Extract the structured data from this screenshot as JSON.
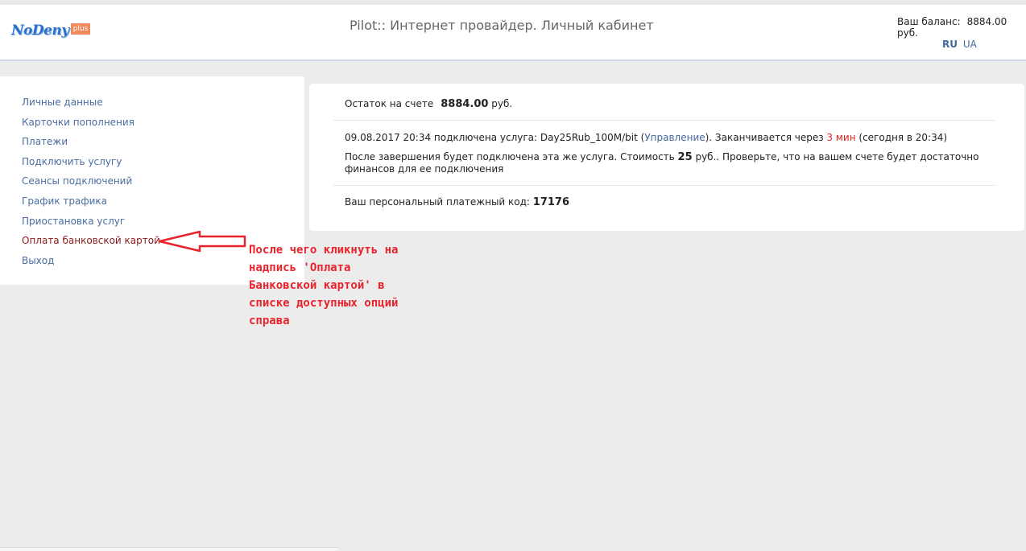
{
  "header": {
    "logo_text": "NoDeny",
    "logo_badge": "plus",
    "title": "Pilot:: Интернет провайдер. Личный кабинет",
    "balance_label": "Ваш баланс:",
    "balance_value": "8884.00 руб.",
    "languages": [
      "RU",
      "UA"
    ],
    "active_language": "RU"
  },
  "sidebar": {
    "items": [
      {
        "label": "Личные данные"
      },
      {
        "label": "Карточки пополнения"
      },
      {
        "label": "Платежи"
      },
      {
        "label": "Подключить услугу"
      },
      {
        "label": "Сеансы подключений"
      },
      {
        "label": "График трафика"
      },
      {
        "label": "Приостановка услуг"
      },
      {
        "label": "Оплата банковской картой",
        "active": true
      },
      {
        "label": "Выход"
      }
    ]
  },
  "main": {
    "balance_label": "Остаток на счете",
    "balance_amount": "8884.00",
    "balance_currency": "руб.",
    "service_prefix": "09.08.2017 20:34 подключена услуга: Day25Rub_100M/bit (",
    "service_link": "Управление",
    "service_mid": "). Заканчивается через ",
    "service_remaining": "3 мин",
    "service_suffix": " (сегодня в 20:34)",
    "renewal_prefix": "После завершения будет подключена эта же услуга. Стоимость ",
    "renewal_cost": "25",
    "renewal_suffix": " руб.. Проверьте, что на вашем счете будет достаточно финансов для ее подключения",
    "payment_code_label": "Ваш персональный платежный код:",
    "payment_code": "17176"
  },
  "annotation": {
    "text": "После чего кликнуть на\nнадпись 'Оплата\nБанковской картой' в\nсписке доступных опций\nсправа",
    "color": "#e8232b"
  },
  "colors": {
    "link": "#4a6ea0",
    "active_link": "#8b1a1a",
    "alert": "#e02020",
    "background": "#ececec"
  }
}
